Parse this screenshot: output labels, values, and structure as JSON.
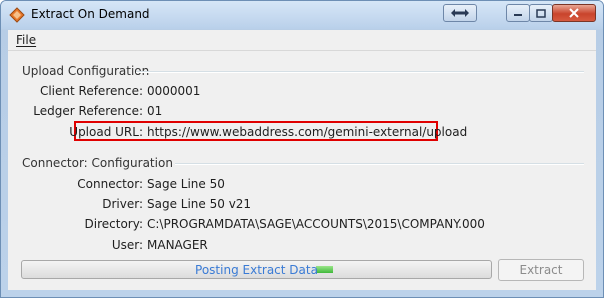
{
  "window": {
    "title": "Extract On Demand"
  },
  "menu": {
    "file": "File"
  },
  "upload": {
    "heading": "Upload Configuration",
    "fields": [
      {
        "label": "Client Reference:",
        "value": "0000001"
      },
      {
        "label": "Ledger Reference:",
        "value": "01"
      },
      {
        "label": "Upload URL:",
        "value": "https://www.webaddress.com/gemini-external/upload"
      }
    ]
  },
  "connector": {
    "heading": "Connector: Configuration",
    "fields": [
      {
        "label": "Connector:",
        "value": "Sage Line 50"
      },
      {
        "label": "Driver:",
        "value": "Sage Line 50 v21"
      },
      {
        "label": "Directory:",
        "value": "C:\\PROGRAMDATA\\SAGE\\ACCOUNTS\\2015\\COMPANY.000"
      },
      {
        "label": "User:",
        "value": "MANAGER"
      }
    ]
  },
  "status": {
    "progress_text": "Posting Extract Data"
  },
  "actions": {
    "extract_label": "Extract"
  },
  "colors": {
    "highlight": "#e00000",
    "progress_text": "#3a7bd5",
    "progress_fill": "#3fb83a"
  }
}
